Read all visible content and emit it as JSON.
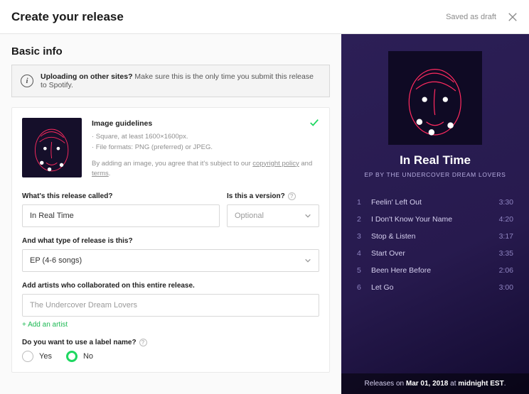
{
  "header": {
    "title": "Create your release",
    "draft_status": "Saved as draft"
  },
  "section_heading": "Basic info",
  "alert": {
    "label_strong": "Uploading on other sites?",
    "label_rest": " Make sure this is the only time you submit this release to Spotify."
  },
  "guidelines": {
    "title": "Image guidelines",
    "bullet1": "· Square, at least 1600×1600px.",
    "bullet2": "· File formats: PNG (preferred) or JPEG.",
    "agree_prefix": "By adding an image, you agree that it's subject to our ",
    "copyright_link": "copyright policy",
    "agree_mid": " and ",
    "terms_link": "terms",
    "agree_suffix": "."
  },
  "fields": {
    "release_name_label": "What's this release called?",
    "release_name_value": "In Real Time",
    "is_version_label": "Is this a version?",
    "is_version_placeholder": "Optional",
    "release_type_label": "And what type of release is this?",
    "release_type_value": "EP (4-6 songs)",
    "collaborators_label": "Add artists who collaborated on this entire release.",
    "collaborators_value": "The Undercover Dream Lovers",
    "add_artist": "+ Add an artist",
    "label_name_label": "Do you want to use a label name?",
    "label_yes": "Yes",
    "label_no": "No",
    "label_selected": "No"
  },
  "preview": {
    "title": "In Real Time",
    "subline": "EP BY THE UNDERCOVER DREAM LOVERS",
    "tracks": [
      {
        "num": "1",
        "name": "Feelin' Left Out",
        "dur": "3:30"
      },
      {
        "num": "2",
        "name": "I Don't Know Your Name",
        "dur": "4:20"
      },
      {
        "num": "3",
        "name": "Stop & Listen",
        "dur": "3:17"
      },
      {
        "num": "4",
        "name": "Start Over",
        "dur": "3:35"
      },
      {
        "num": "5",
        "name": "Been Here Before",
        "dur": "2:06"
      },
      {
        "num": "6",
        "name": "Let Go",
        "dur": "3:00"
      }
    ],
    "footer_prefix": "Releases on ",
    "footer_date": "Mar 01, 2018",
    "footer_mid": " at ",
    "footer_time": "midnight EST",
    "footer_suffix": "."
  }
}
